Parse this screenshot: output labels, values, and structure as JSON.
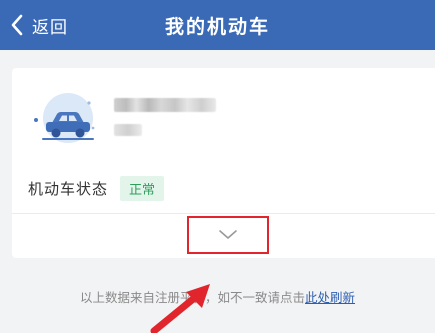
{
  "header": {
    "back_label": "返回",
    "title": "我的机动车",
    "background_color": "#3a6ab6"
  },
  "vehicle_card": {
    "avatar_icon": "car-icon",
    "status_label": "机动车状态",
    "status_value": "正常",
    "status_color": "#2f9e5c",
    "expand_icon": "chevron-down-icon"
  },
  "footer": {
    "note_prefix": "以上数据来自注册平台，如不一致请点击",
    "refresh_link": "此处刷新",
    "link_color": "#2d5fb0"
  },
  "annotations": {
    "highlight_box_color": "#e0262c",
    "pointer_icon": "red-arrow-icon"
  }
}
